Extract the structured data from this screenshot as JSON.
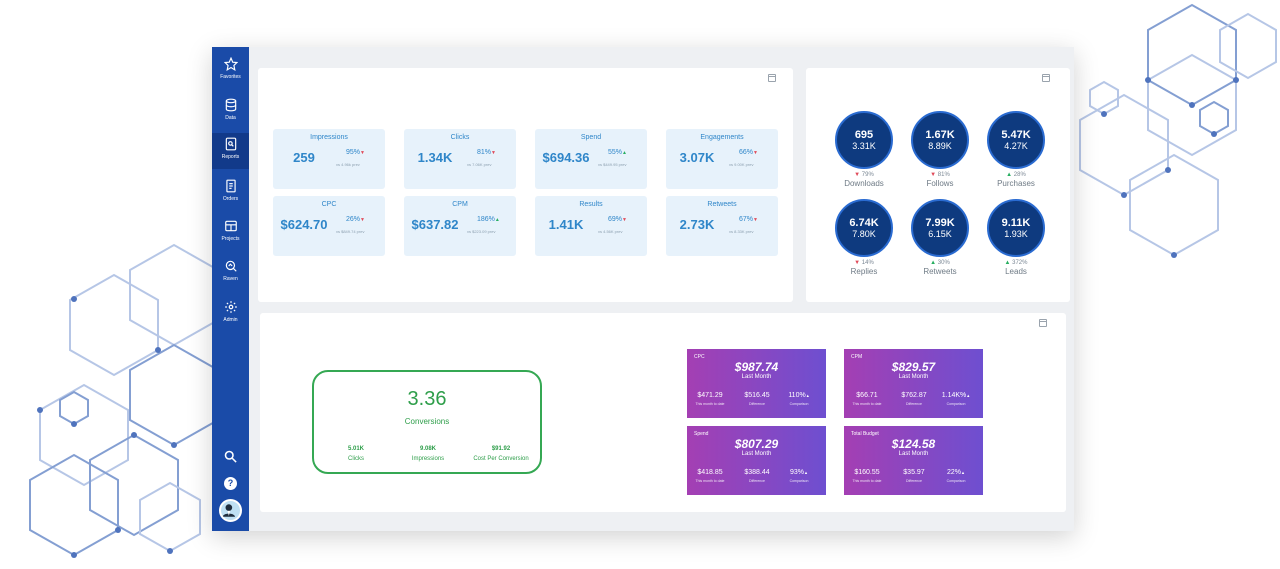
{
  "sidebar": {
    "items": [
      {
        "label": "Favorites",
        "icon": "star-icon"
      },
      {
        "label": "Data",
        "icon": "database-icon"
      },
      {
        "label": "Reports",
        "icon": "report-icon"
      },
      {
        "label": "Orders",
        "icon": "orders-icon"
      },
      {
        "label": "Projects",
        "icon": "projects-icon"
      },
      {
        "label": "Raven",
        "icon": "raven-icon"
      },
      {
        "label": "Admin",
        "icon": "gear-icon"
      }
    ],
    "help_label": "?"
  },
  "kpis": [
    {
      "title": "Impressions",
      "value": "259",
      "pct": "95%",
      "dir": "down",
      "prev": "vs 4.96k prev"
    },
    {
      "title": "Clicks",
      "value": "1.34K",
      "pct": "81%",
      "dir": "down",
      "prev": "vs 7.06K prev"
    },
    {
      "title": "Spend",
      "value": "$694.36",
      "pct": "55%",
      "dir": "up",
      "prev": "vs $449.95 prev"
    },
    {
      "title": "Engagements",
      "value": "3.07K",
      "pct": "66%",
      "dir": "down",
      "prev": "vs 9.00K prev"
    },
    {
      "title": "CPC",
      "value": "$624.70",
      "pct": "26%",
      "dir": "down",
      "prev": "vs $849.74 prev"
    },
    {
      "title": "CPM",
      "value": "$637.82",
      "pct": "186%",
      "dir": "up",
      "prev": "vs $223.09 prev"
    },
    {
      "title": "Results",
      "value": "1.41K",
      "pct": "69%",
      "dir": "down",
      "prev": "vs 4.56K prev"
    },
    {
      "title": "Retweets",
      "value": "2.73K",
      "pct": "67%",
      "dir": "down",
      "prev": "vs 8.33K prev"
    }
  ],
  "circles": [
    {
      "v1": "695",
      "v2": "3.31K",
      "change": "79%",
      "dir": "down",
      "label": "Downloads"
    },
    {
      "v1": "1.67K",
      "v2": "8.89K",
      "change": "81%",
      "dir": "down",
      "label": "Follows"
    },
    {
      "v1": "5.47K",
      "v2": "4.27K",
      "change": "28%",
      "dir": "up",
      "label": "Purchases"
    },
    {
      "v1": "6.74K",
      "v2": "7.80K",
      "change": "14%",
      "dir": "down",
      "label": "Replies"
    },
    {
      "v1": "7.99K",
      "v2": "6.15K",
      "change": "30%",
      "dir": "up",
      "label": "Retweets"
    },
    {
      "v1": "9.11K",
      "v2": "1.93K",
      "change": "372%",
      "dir": "up",
      "label": "Leads"
    }
  ],
  "conversions": {
    "value": "3.36",
    "label": "Conversions",
    "stats": [
      {
        "value": "5.01K",
        "label": "Clicks"
      },
      {
        "value": "9.08K",
        "label": "Impressions"
      },
      {
        "value": "$91.92",
        "label": "Cost Per Conversion"
      }
    ]
  },
  "cards": [
    {
      "title": "CPC",
      "value": "$987.74",
      "sub": "Last Month",
      "stats": [
        {
          "v": "$471.29",
          "l": "This month to date"
        },
        {
          "v": "$516.45",
          "l": "Difference"
        },
        {
          "v": "110%",
          "l": "Comparison",
          "dir": "up"
        }
      ]
    },
    {
      "title": "CPM",
      "value": "$829.57",
      "sub": "Last Month",
      "stats": [
        {
          "v": "$66.71",
          "l": "This month to date"
        },
        {
          "v": "$762.87",
          "l": "Difference"
        },
        {
          "v": "1.14K%",
          "l": "Comparison",
          "dir": "up"
        }
      ]
    },
    {
      "title": "Spend",
      "value": "$807.29",
      "sub": "Last Month",
      "stats": [
        {
          "v": "$418.85",
          "l": "This month to date"
        },
        {
          "v": "$388.44",
          "l": "Difference"
        },
        {
          "v": "93%",
          "l": "Comparison",
          "dir": "up"
        }
      ]
    },
    {
      "title": "Total Budget",
      "value": "$124.58",
      "sub": "Last Month",
      "stats": [
        {
          "v": "$160.55",
          "l": "This month to date"
        },
        {
          "v": "$35.97",
          "l": "Difference"
        },
        {
          "v": "22%",
          "l": "Comparison",
          "dir": "up"
        }
      ]
    }
  ],
  "colors": {
    "sidebar": "#1a4ba8",
    "kpi_text": "#2f86c9",
    "circle": "#0e3a7f",
    "conversion": "#35a853",
    "card_from": "#a43fb3",
    "card_to": "#6e4fd0",
    "up": "#27ae60",
    "down": "#e04b5a"
  }
}
